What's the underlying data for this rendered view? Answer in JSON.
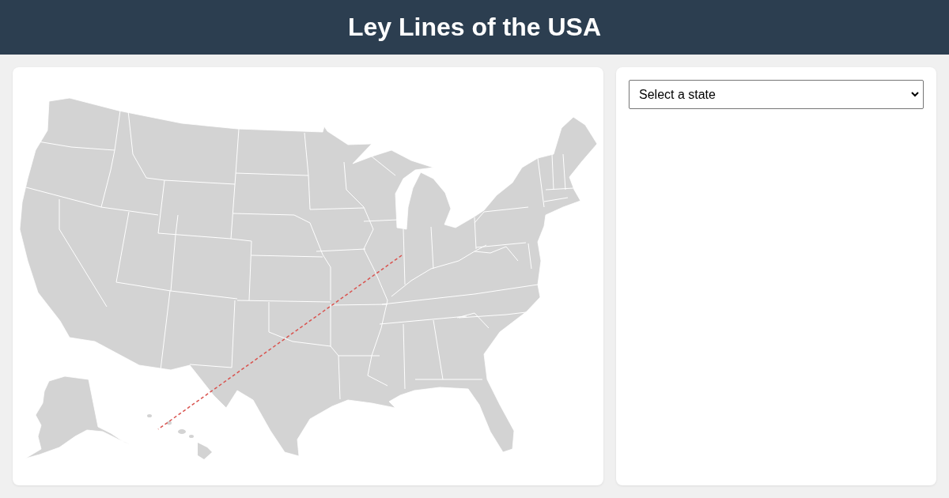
{
  "header": {
    "title": "Ley Lines of the USA"
  },
  "state_select": {
    "value": "Select a state"
  }
}
